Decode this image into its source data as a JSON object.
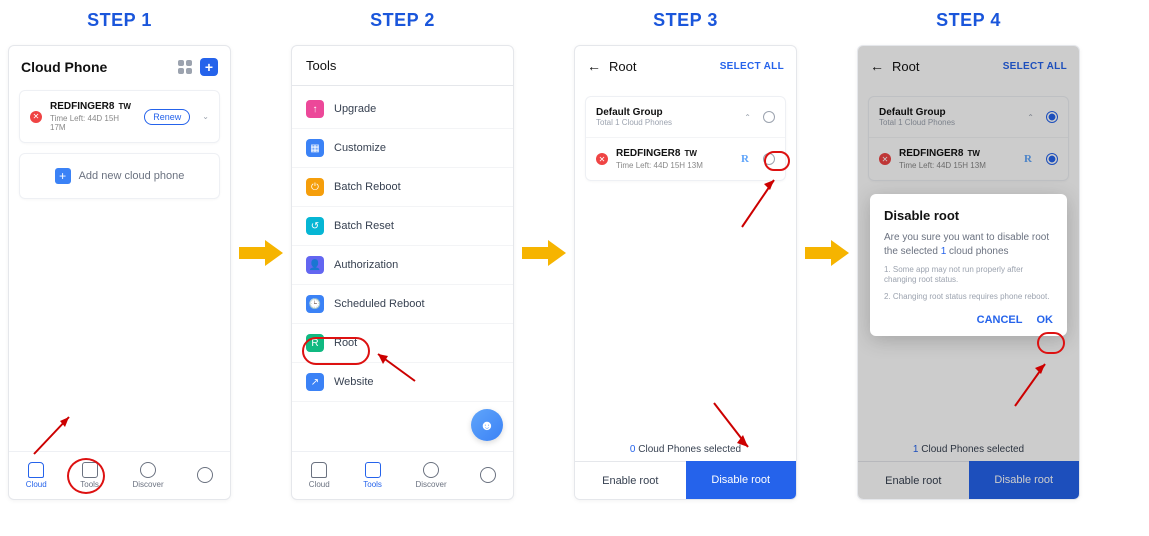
{
  "steps": {
    "s1": "STEP 1",
    "s2": "STEP 2",
    "s3": "STEP 3",
    "s4": "STEP 4"
  },
  "step1": {
    "title": "Cloud Phone",
    "device_name": "REDFINGER8",
    "device_tag": "TW",
    "time_left": "Time Left: 44D 15H 17M",
    "renew": "Renew",
    "add": "Add new cloud phone",
    "nav": {
      "cloud": "Cloud",
      "tools": "Tools",
      "discover": "Discover",
      "me": ""
    }
  },
  "step2": {
    "title": "Tools",
    "items": {
      "upgrade": "Upgrade",
      "customize": "Customize",
      "batch_reboot": "Batch Reboot",
      "batch_reset": "Batch Reset",
      "authorization": "Authorization",
      "scheduled": "Scheduled Reboot",
      "root": "Root",
      "website": "Website"
    },
    "nav": {
      "cloud": "Cloud",
      "tools": "Tools",
      "discover": "Discover",
      "me": ""
    }
  },
  "step3": {
    "title": "Root",
    "select_all": "SELECT ALL",
    "group_name": "Default Group",
    "group_sub": "Total 1 Cloud Phones",
    "device_name": "REDFINGER8",
    "device_tag": "TW",
    "time_left": "Time Left: 44D 15H 13M",
    "r_badge": "R",
    "selected_count": "0",
    "selected_text": " Cloud Phones selected",
    "enable": "Enable root",
    "disable": "Disable root"
  },
  "step4": {
    "title": "Root",
    "select_all": "SELECT ALL",
    "group_name": "Default Group",
    "group_sub": "Total 1 Cloud Phones",
    "device_name": "REDFINGER8",
    "device_tag": "TW",
    "time_left": "Time Left: 44D 15H 13M",
    "r_badge": "R",
    "modal": {
      "title": "Disable root",
      "line1a": "Are you sure you want to disable root the selected ",
      "count": "1",
      "line1b": " cloud phones",
      "note1": "1. Some app may not run properly after changing root status.",
      "note2": "2. Changing root status requires phone reboot.",
      "cancel": "CANCEL",
      "ok": "OK"
    },
    "selected_count": "1",
    "selected_text": " Cloud Phones selected",
    "enable": "Enable root",
    "disable": "Disable root"
  }
}
